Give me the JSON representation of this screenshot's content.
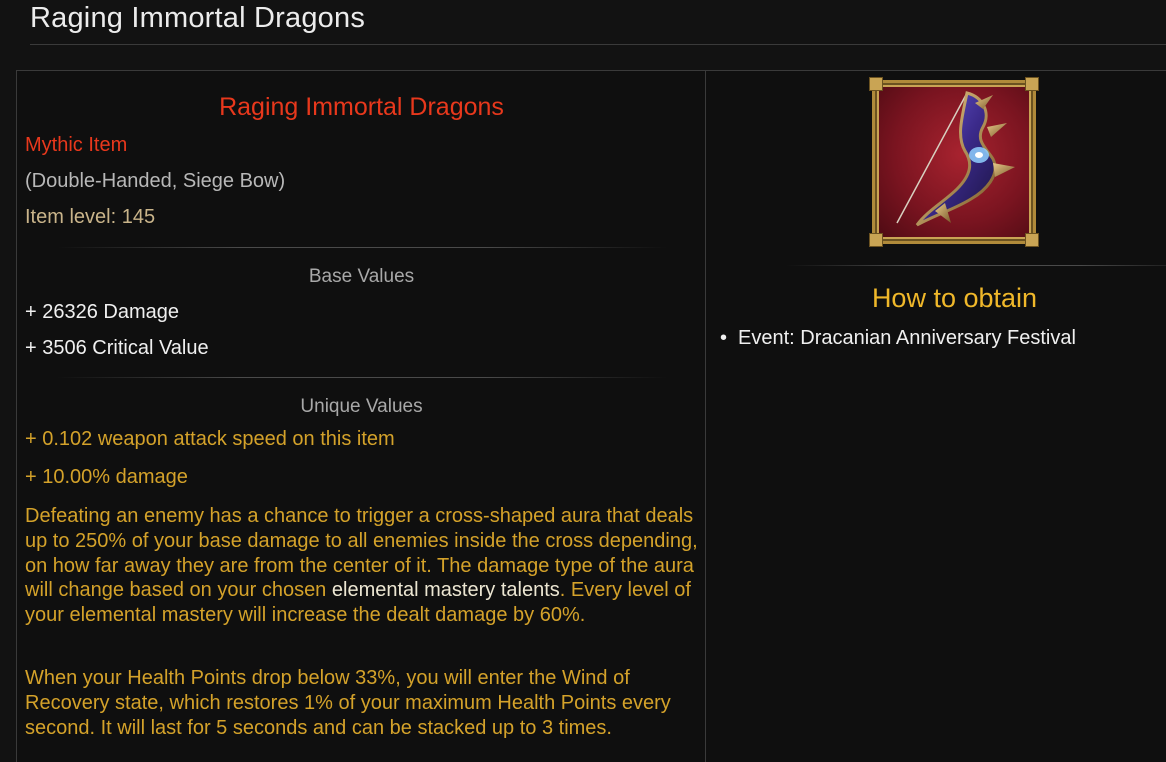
{
  "page": {
    "title": "Raging Immortal Dragons"
  },
  "item": {
    "name": "Raging Immortal Dragons",
    "rarity": "Mythic Item",
    "type": "(Double-Handed, Siege Bow)",
    "item_level": "Item level: 145",
    "image_icon": "siege-bow-icon"
  },
  "base_values": {
    "heading": "Base Values",
    "stats": [
      "+ 26326 Damage",
      "+ 3506 Critical Value"
    ]
  },
  "unique_values": {
    "heading": "Unique Values",
    "stats": [
      "+ 0.102 weapon attack speed on this item",
      "+ 10.00% damage"
    ],
    "effect_1_before": "Defeating an enemy has a chance to trigger a cross-shaped aura that deals up to 250% of your base damage to all enemies inside the cross depending, on how far away they are from the center of it. The damage type of the aura will change based on your chosen ",
    "effect_1_link": "elemental mastery talents",
    "effect_1_after": ". Every level of your elemental mastery will increase the dealt damage by 60%.",
    "effect_2": "When your Health Points drop below 33%, you will enter the Wind of Recovery state, which restores 1% of your maximum Health Points every second. It will last for 5 seconds and can be stacked up to 3 times."
  },
  "obtain": {
    "heading": "How to obtain",
    "sources": [
      "Event: Dracanian Anniversary Festival"
    ]
  },
  "colors": {
    "mythic": "#e8381c",
    "unique": "#d4a22a",
    "obtain_heading": "#f0b82a"
  }
}
